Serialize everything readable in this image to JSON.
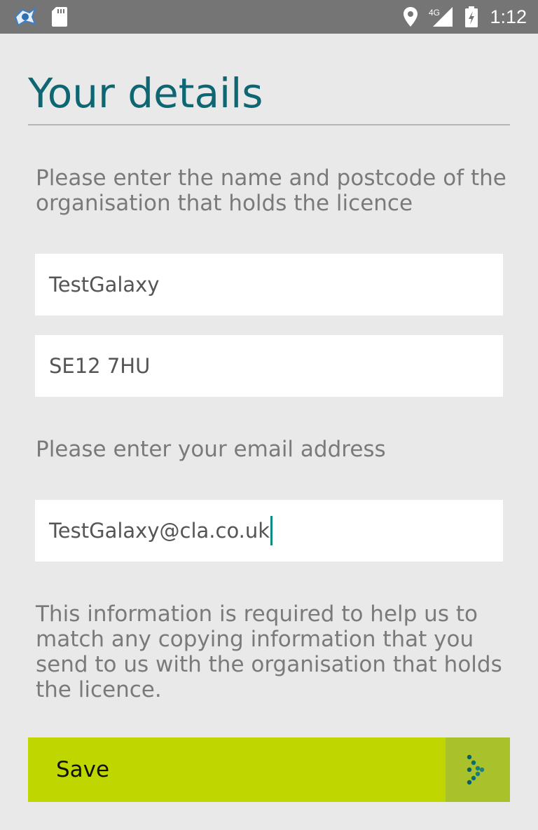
{
  "status_bar": {
    "time": "1:12",
    "network": "4G",
    "background_color": "#757575"
  },
  "page": {
    "title": "Your details",
    "licence_instruction": "Please enter the name and postcode of the organisation that holds the licence",
    "email_instruction": "Please enter your email address",
    "info_text": "This information is required to help us to match any copying information that you send to us with the organisation that holds the licence."
  },
  "form": {
    "organisation_name": "TestGalaxy",
    "postcode": "SE12 7HU",
    "email": "TestGalaxy@cla.co.uk"
  },
  "save_button": {
    "label": "Save",
    "color": "#bfd600"
  },
  "colors": {
    "title": "#0d6672",
    "background": "#e9e9e9",
    "cursor": "#0d8a84"
  },
  "icons": {
    "status_left": [
      "app-notification-icon",
      "sd-card-icon"
    ],
    "status_right": [
      "location-icon",
      "signal-icon",
      "battery-charging-icon"
    ],
    "save": "dotted-arrow-icon"
  }
}
